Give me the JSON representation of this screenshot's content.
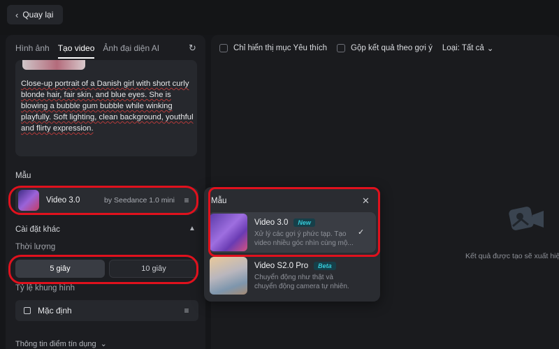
{
  "header": {
    "back_label": "Quay lại"
  },
  "tabs": [
    {
      "label": "Hình ảnh",
      "active": false
    },
    {
      "label": "Tạo video",
      "active": true
    },
    {
      "label": "Ảnh đại diện AI",
      "active": false
    }
  ],
  "prompt": {
    "text": "Close-up portrait of a Danish girl with short curly blonde hair, fair skin, and blue eyes. She is blowing a bubble gum bubble while winking playfully. Soft lighting, clean background, youthful and flirty expression."
  },
  "model_section": {
    "label": "Mẫu",
    "selected_name": "Video 3.0",
    "selected_by": "by Seedance 1.0 mini"
  },
  "other_settings": {
    "label": "Cài đặt khác",
    "duration_label": "Thời lượng",
    "duration_options": [
      "5 giây",
      "10 giây"
    ],
    "selected_duration": "5 giây",
    "ratio_label": "Tỷ lệ khung hình",
    "ratio_value": "Mặc định"
  },
  "credit_info": {
    "label": "Thông tin điểm tín dụng"
  },
  "filters": {
    "favorites": "Chỉ hiển thị mục Yêu thích",
    "group": "Gộp kết quả theo gợi ý",
    "type": "Loại: Tất cả"
  },
  "empty_state": {
    "text": "Kết quả được tạo sẽ xuất hiệ"
  },
  "model_popup": {
    "title": "Mẫu",
    "items": [
      {
        "name": "Video 3.0",
        "badge": "New",
        "desc": "Xử lý các gợi ý phức tạp. Tạo video nhiều góc nhìn cùng mộ...",
        "selected": true
      },
      {
        "name": "Video S2.0 Pro",
        "badge": "Beta",
        "desc": "Chuyển động như thật và chuyển động camera tự nhiên.",
        "selected": false
      }
    ]
  },
  "colors": {
    "highlight": "#e0111d",
    "badge": "#35c9d8",
    "background": "#151619"
  }
}
